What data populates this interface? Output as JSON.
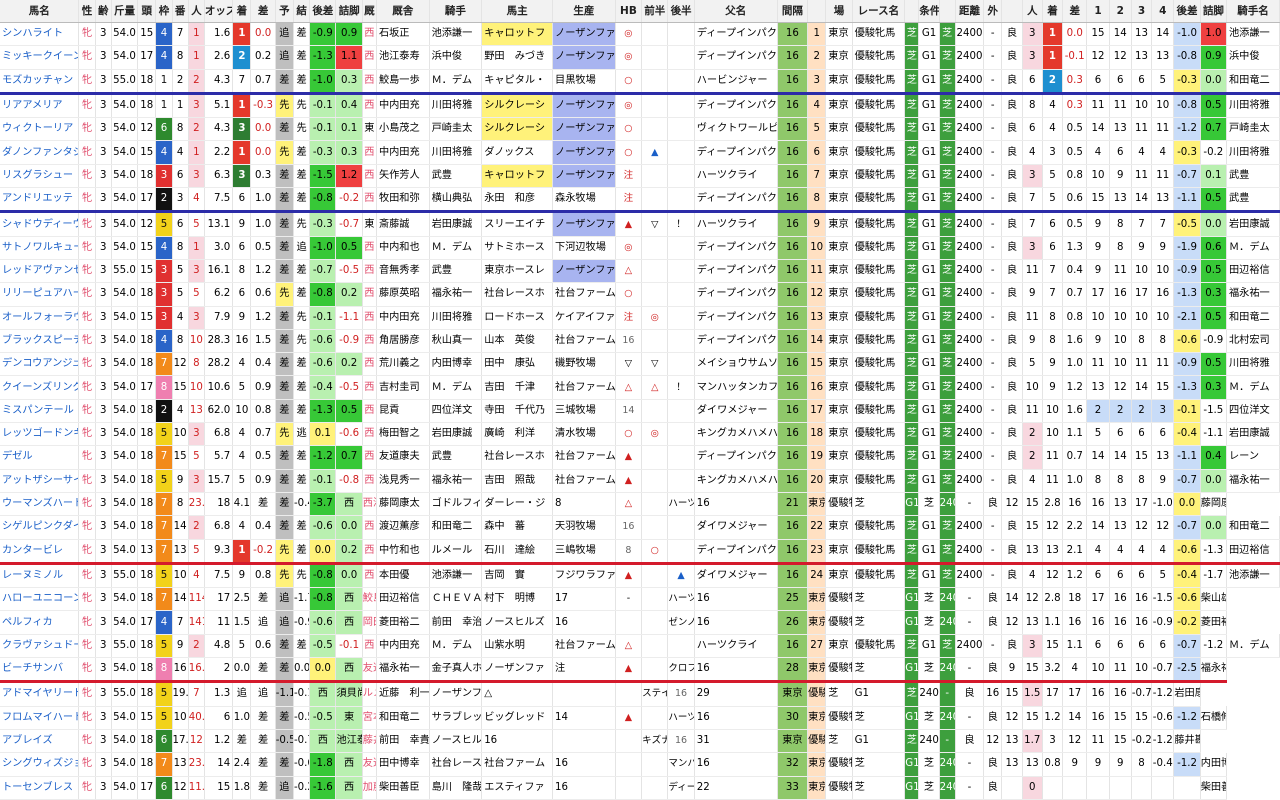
{
  "headers": [
    "馬名",
    "性",
    "齢",
    "斤量",
    "頭",
    "枠",
    "番",
    "人",
    "オッズ",
    "着",
    "差",
    "予",
    "結",
    "後差",
    "詰脚",
    "厩",
    "厩舎",
    "騎手",
    "馬主",
    "生産",
    "HB",
    "前半",
    "後半",
    "父名",
    "間隔",
    "",
    "場",
    "レース名",
    "",
    "条件",
    "",
    "距離",
    "外",
    "",
    "人",
    "着",
    "差",
    "1",
    "2",
    "3",
    "4",
    "後差",
    "詰脚",
    "騎手名"
  ],
  "colors": {
    "blue_sep": "#2c2ca8",
    "red_sep": "#d41a2c",
    "name_blue": "#1a5fc8",
    "green": "#37c837",
    "red": "#ef4040"
  },
  "rows": [
    [
      "シンハライト",
      "牝",
      "3",
      "54.0",
      "15",
      "4",
      "7",
      "1",
      "1.6",
      "1",
      "0.0",
      "追",
      "差",
      "-0.9",
      "0.9",
      "西",
      "石坂正",
      "池添謙一",
      "キャロットフ",
      "ノーザンファ",
      "◎",
      "",
      "",
      "ディープインパクト",
      "16",
      "1",
      "東京",
      "優駿牝馬",
      "芝",
      "G1",
      "芝",
      "2400",
      "-",
      "良",
      "3",
      "1",
      "0.0",
      "15",
      "14",
      "13",
      "14",
      "-1.0",
      "1.0",
      "池添謙一"
    ],
    [
      "ミッキークイーン",
      "牝",
      "3",
      "54.0",
      "17",
      "4",
      "8",
      "1",
      "2.6",
      "2",
      "0.2",
      "追",
      "差",
      "-1.3",
      "1.1",
      "西",
      "池江泰寿",
      "浜中俊",
      "野田　みづき",
      "ノーザンファ",
      "◎",
      "",
      "",
      "ディープインパクト",
      "16",
      "2",
      "東京",
      "優駿牝馬",
      "芝",
      "G1",
      "芝",
      "2400",
      "-",
      "良",
      "3",
      "1",
      "-0.1",
      "12",
      "12",
      "13",
      "13",
      "-0.8",
      "0.9",
      "浜中俊"
    ],
    [
      "モズカッチャン",
      "牝",
      "3",
      "55.0",
      "18",
      "1",
      "2",
      "2",
      "4.3",
      "7",
      "0.7",
      "差",
      "差",
      "-1.0",
      "0.3",
      "西",
      "鮫島一歩",
      "Ｍ．デム",
      "キャピタル・",
      "目黒牧場",
      "○",
      "",
      "",
      "ハービンジャー",
      "16",
      "3",
      "東京",
      "優駿牝馬",
      "芝",
      "G1",
      "芝",
      "2400",
      "-",
      "良",
      "6",
      "2",
      "0.3",
      "6",
      "6",
      "6",
      "5",
      "-0.3",
      "0.0",
      "和田竜二"
    ],
    [
      "リアアメリア",
      "牝",
      "3",
      "54.0",
      "18",
      "1",
      "1",
      "3",
      "5.1",
      "1",
      "-0.3",
      "先",
      "先",
      "-0.1",
      "0.4",
      "西",
      "中内田充",
      "川田将雅",
      "シルクレーシ",
      "ノーザンファ",
      "◎",
      "",
      "",
      "ディープインパクト",
      "16",
      "4",
      "東京",
      "優駿牝馬",
      "芝",
      "G1",
      "芝",
      "2400",
      "-",
      "良",
      "8",
      "4",
      "0.3",
      "11",
      "11",
      "10",
      "10",
      "-0.8",
      "0.5",
      "川田将雅"
    ],
    [
      "ウィクトーリア",
      "牝",
      "3",
      "54.0",
      "12",
      "6",
      "8",
      "2",
      "4.3",
      "3",
      "0.0",
      "差",
      "先",
      "-0.1",
      "0.1",
      "東",
      "小島茂之",
      "戸崎圭太",
      "シルクレーシ",
      "ノーザンファ",
      "○",
      "",
      "",
      "ヴィクトワールピサ",
      "16",
      "5",
      "東京",
      "優駿牝馬",
      "芝",
      "G1",
      "芝",
      "2400",
      "-",
      "良",
      "6",
      "4",
      "0.5",
      "14",
      "13",
      "11",
      "11",
      "-1.2",
      "0.7",
      "戸崎圭太"
    ],
    [
      "ダノンファンタジー",
      "牝",
      "3",
      "54.0",
      "15",
      "4",
      "4",
      "1",
      "2.2",
      "1",
      "0.0",
      "先",
      "差",
      "-0.3",
      "0.3",
      "西",
      "中内田充",
      "川田将雅",
      "ダノックス",
      "ノーザンファ",
      "○",
      "▲",
      "",
      "ディープインパクト",
      "16",
      "6",
      "東京",
      "優駿牝馬",
      "芝",
      "G1",
      "芝",
      "2400",
      "-",
      "良",
      "4",
      "3",
      "0.5",
      "4",
      "6",
      "4",
      "4",
      "-0.3",
      "-0.2",
      "川田将雅"
    ],
    [
      "リスグラシュー",
      "牝",
      "3",
      "54.0",
      "18",
      "3",
      "6",
      "3",
      "6.3",
      "3",
      "0.3",
      "差",
      "差",
      "-1.5",
      "1.2",
      "西",
      "矢作芳人",
      "武豊",
      "キャロットフ",
      "ノーザンファ",
      "注",
      "",
      "",
      "ハーツクライ",
      "16",
      "7",
      "東京",
      "優駿牝馬",
      "芝",
      "G1",
      "芝",
      "2400",
      "-",
      "良",
      "3",
      "5",
      "0.8",
      "10",
      "9",
      "11",
      "11",
      "-0.7",
      "0.1",
      "武豊"
    ],
    [
      "アンドリエッテ",
      "牝",
      "3",
      "54.0",
      "17",
      "2",
      "3",
      "4",
      "7.5",
      "6",
      "1.0",
      "差",
      "差",
      "-0.8",
      "-0.2",
      "西",
      "牧田和弥",
      "横山典弘",
      "永田　和彦",
      "森永牧場",
      "注",
      "",
      "",
      "ディープインパクト",
      "16",
      "8",
      "東京",
      "優駿牝馬",
      "芝",
      "G1",
      "芝",
      "2400",
      "-",
      "良",
      "7",
      "5",
      "0.6",
      "15",
      "13",
      "14",
      "13",
      "-1.1",
      "0.5",
      "武豊"
    ],
    [
      "シャドウディーヴァ",
      "牝",
      "3",
      "54.0",
      "12",
      "5",
      "6",
      "5",
      "13.1",
      "9",
      "1.0",
      "差",
      "先",
      "-0.3",
      "-0.7",
      "東",
      "斎藤誠",
      "岩田康誠",
      "スリーエイチ",
      "ノーザンファ",
      "▲",
      "▽",
      "！",
      "ハーツクライ",
      "16",
      "9",
      "東京",
      "優駿牝馬",
      "芝",
      "G1",
      "芝",
      "2400",
      "-",
      "良",
      "7",
      "6",
      "0.5",
      "9",
      "8",
      "7",
      "7",
      "-0.5",
      "0.0",
      "岩田康誠"
    ],
    [
      "サトノワルキューレ",
      "牝",
      "3",
      "54.0",
      "15",
      "4",
      "8",
      "1",
      "3.0",
      "6",
      "0.5",
      "差",
      "追",
      "-1.0",
      "0.5",
      "西",
      "中内和也",
      "Ｍ．デム",
      "サトミホース",
      "下河辺牧場",
      "◎",
      "",
      "",
      "ディープインパクト",
      "16",
      "10",
      "東京",
      "優駿牝馬",
      "芝",
      "G1",
      "芝",
      "2400",
      "-",
      "良",
      "3",
      "6",
      "1.3",
      "9",
      "8",
      "9",
      "9",
      "-1.9",
      "0.6",
      "Ｍ．デム"
    ],
    [
      "レッドアヴァンセ",
      "牝",
      "3",
      "55.0",
      "15",
      "3",
      "5",
      "3",
      "16.1",
      "8",
      "1.2",
      "差",
      "差",
      "-0.7",
      "-0.5",
      "西",
      "音無秀孝",
      "武豊",
      "東京ホースレ",
      "ノーザンファ",
      "△",
      "",
      "",
      "ディープインパクト",
      "16",
      "11",
      "東京",
      "優駿牝馬",
      "芝",
      "G1",
      "芝",
      "2400",
      "-",
      "良",
      "11",
      "7",
      "0.4",
      "9",
      "11",
      "10",
      "10",
      "-0.9",
      "0.5",
      "田辺裕信"
    ],
    [
      "リリーピュアハート",
      "牝",
      "3",
      "54.0",
      "18",
      "3",
      "5",
      "5",
      "6.2",
      "6",
      "0.6",
      "先",
      "差",
      "-0.8",
      "0.2",
      "西",
      "藤原英昭",
      "福永祐一",
      "社台レースホ",
      "社台ファーム",
      "○",
      "",
      "",
      "ディープインパクト",
      "16",
      "12",
      "東京",
      "優駿牝馬",
      "芝",
      "G1",
      "芝",
      "2400",
      "-",
      "良",
      "9",
      "7",
      "0.7",
      "17",
      "16",
      "17",
      "16",
      "-1.3",
      "0.3",
      "福永祐一"
    ],
    [
      "オールフォーラヴ",
      "牝",
      "3",
      "54.0",
      "15",
      "3",
      "4",
      "3",
      "7.9",
      "9",
      "1.2",
      "差",
      "先",
      "-0.1",
      "-1.1",
      "西",
      "中内田充",
      "川田将雅",
      "ロードホース",
      "ケイアイファ",
      "注",
      "◎",
      "",
      "ディープインパクト",
      "16",
      "13",
      "東京",
      "優駿牝馬",
      "芝",
      "G1",
      "芝",
      "2400",
      "-",
      "良",
      "11",
      "8",
      "0.8",
      "10",
      "10",
      "10",
      "10",
      "-2.1",
      "0.5",
      "和田竜二"
    ],
    [
      "ブラックスピーチ",
      "牝",
      "3",
      "54.0",
      "18",
      "4",
      "8",
      "10",
      "28.3",
      "16",
      "1.5",
      "差",
      "先",
      "-0.6",
      "-0.9",
      "西",
      "角居勝彦",
      "秋山真一",
      "山本　英俊",
      "社台ファーム",
      "16",
      "",
      "",
      "ディープインパクト",
      "16",
      "14",
      "東京",
      "優駿牝馬",
      "芝",
      "G1",
      "芝",
      "2400",
      "-",
      "良",
      "9",
      "8",
      "1.6",
      "9",
      "10",
      "8",
      "8",
      "-0.6",
      "-0.9",
      "北村宏司"
    ],
    [
      "デンコウアンジュ",
      "牝",
      "3",
      "54.0",
      "18",
      "7",
      "12",
      "8",
      "28.2",
      "4",
      "0.4",
      "差",
      "差",
      "-0.6",
      "0.2",
      "西",
      "荒川義之",
      "内田博幸",
      "田中　康弘",
      "磯野牧場",
      "▽",
      "▽",
      "",
      "メイショウサムソン",
      "16",
      "15",
      "東京",
      "優駿牝馬",
      "芝",
      "G1",
      "芝",
      "2400",
      "-",
      "良",
      "5",
      "9",
      "1.0",
      "11",
      "10",
      "11",
      "11",
      "-0.9",
      "0.5",
      "川田将雅"
    ],
    [
      "クイーンズリング",
      "牝",
      "3",
      "54.0",
      "17",
      "8",
      "15",
      "10",
      "10.6",
      "5",
      "0.9",
      "差",
      "差",
      "-0.4",
      "-0.5",
      "西",
      "吉村圭司",
      "Ｍ．デム",
      "吉田　千津",
      "社台ファーム",
      "△",
      "△",
      "！",
      "マンハッタンカフェ",
      "16",
      "16",
      "東京",
      "優駿牝馬",
      "芝",
      "G1",
      "芝",
      "2400",
      "-",
      "良",
      "10",
      "9",
      "1.2",
      "13",
      "12",
      "14",
      "15",
      "-1.3",
      "0.3",
      "Ｍ．デム"
    ],
    [
      "ミスパンテール",
      "牝",
      "3",
      "54.0",
      "18",
      "2",
      "4",
      "13",
      "62.0",
      "10",
      "0.8",
      "差",
      "差",
      "-1.3",
      "0.5",
      "西",
      "昆貢",
      "四位洋文",
      "寺田　千代乃",
      "三城牧場",
      "14",
      "",
      "",
      "ダイワメジャー",
      "16",
      "17",
      "東京",
      "優駿牝馬",
      "芝",
      "G1",
      "芝",
      "2400",
      "-",
      "良",
      "11",
      "10",
      "1.6",
      "2",
      "2",
      "2",
      "3",
      "-0.1",
      "-1.5",
      "四位洋文"
    ],
    [
      "レッツゴードンキ",
      "牝",
      "3",
      "54.0",
      "18",
      "5",
      "10",
      "3",
      "6.8",
      "4",
      "0.7",
      "先",
      "逃",
      "0.1",
      "-0.6",
      "西",
      "梅田智之",
      "岩田康誠",
      "廣崎　利洋",
      "清水牧場",
      "○",
      "◎",
      "",
      "キングカメハメハ",
      "16",
      "18",
      "東京",
      "優駿牝馬",
      "芝",
      "G1",
      "芝",
      "2400",
      "-",
      "良",
      "2",
      "10",
      "1.1",
      "5",
      "6",
      "6",
      "6",
      "-0.4",
      "-1.1",
      "岩田康誠"
    ],
    [
      "デゼル",
      "牝",
      "3",
      "54.0",
      "18",
      "7",
      "15",
      "5",
      "5.7",
      "4",
      "0.5",
      "差",
      "差",
      "-1.2",
      "0.7",
      "西",
      "友道康夫",
      "武豊",
      "社台レースホ",
      "社台ファーム",
      "▲",
      "",
      "",
      "ディープインパクト",
      "16",
      "19",
      "東京",
      "優駿牝馬",
      "芝",
      "G1",
      "芝",
      "2400",
      "-",
      "良",
      "2",
      "11",
      "0.7",
      "14",
      "14",
      "15",
      "13",
      "-1.1",
      "0.4",
      "レーン"
    ],
    [
      "アットザシーサイド",
      "牝",
      "3",
      "54.0",
      "18",
      "5",
      "9",
      "3",
      "15.7",
      "5",
      "0.9",
      "差",
      "差",
      "-0.1",
      "-0.8",
      "西",
      "浅見秀一",
      "福永祐一",
      "吉田　照哉",
      "社台ファーム",
      "▲",
      "",
      "",
      "キングカメハメハ",
      "16",
      "20",
      "東京",
      "優駿牝馬",
      "芝",
      "G1",
      "芝",
      "2400",
      "-",
      "良",
      "4",
      "11",
      "1.0",
      "8",
      "8",
      "8",
      "9",
      "-0.7",
      "0.0",
      "福永祐一"
    ],
    [
      "ウーマンズハート",
      "牝",
      "3",
      "54.0",
      "18",
      "7",
      "8",
      "23.3",
      "18",
      "4.1",
      "差",
      "差",
      "-0.4",
      "-3.7",
      "西",
      "西浦勝一",
      "藤岡康太",
      "ゴドルフィン",
      "ダーレー・ジ",
      "8",
      "△",
      "",
      "ハーツクライ",
      "16",
      "21",
      "東京",
      "優駿牝馬",
      "芝",
      "G1",
      "芝",
      "2400",
      "-",
      "良",
      "12",
      "15",
      "2.8",
      "16",
      "16",
      "13",
      "17",
      "-1.0",
      "0.0",
      "藤岡康太"
    ],
    [
      "シゲルピンクダイヤ",
      "牝",
      "3",
      "54.0",
      "18",
      "7",
      "14",
      "2",
      "6.8",
      "4",
      "0.4",
      "差",
      "差",
      "-0.6",
      "0.0",
      "西",
      "渡辺薫彦",
      "和田竜二",
      "森中　蕃",
      "天羽牧場",
      "16",
      "",
      "",
      "ダイワメジャー",
      "16",
      "22",
      "東京",
      "優駿牝馬",
      "芝",
      "G1",
      "芝",
      "2400",
      "-",
      "良",
      "15",
      "12",
      "2.2",
      "14",
      "13",
      "12",
      "12",
      "-0.7",
      "0.0",
      "和田竜二"
    ],
    [
      "カンタービレ",
      "牝",
      "3",
      "54.0",
      "13",
      "7",
      "13",
      "5",
      "9.3",
      "1",
      "-0.2",
      "先",
      "差",
      "0.0",
      "0.2",
      "西",
      "中竹和也",
      "ルメール",
      "石川　達絵",
      "三嶋牧場",
      "8",
      "○",
      "",
      "ディープインパクト",
      "16",
      "23",
      "東京",
      "優駿牝馬",
      "芝",
      "G1",
      "芝",
      "2400",
      "-",
      "良",
      "13",
      "13",
      "2.1",
      "4",
      "4",
      "4",
      "4",
      "-0.6",
      "-1.3",
      "田辺裕信"
    ],
    [
      "レーヌミノル",
      "牝",
      "3",
      "55.0",
      "18",
      "5",
      "10",
      "4",
      "7.5",
      "9",
      "0.8",
      "先",
      "先",
      "-0.8",
      "0.0",
      "西",
      "本田優",
      "池添謙一",
      "吉岡　實",
      "フジワラファ",
      "▲",
      "",
      "▲",
      "ダイワメジャー",
      "16",
      "24",
      "東京",
      "優駿牝馬",
      "芝",
      "G1",
      "芝",
      "2400",
      "-",
      "良",
      "4",
      "12",
      "1.2",
      "6",
      "6",
      "6",
      "5",
      "-0.4",
      "-1.7",
      "池添謙一"
    ],
    [
      "ハローユニコーン",
      "牝",
      "3",
      "54.0",
      "18",
      "7",
      "14",
      "114.1",
      "17",
      "2.5",
      "差",
      "追",
      "-1.7",
      "-0.8",
      "西",
      "鮫島一歩",
      "田辺裕信",
      "ＣＨＥＶＡＬ",
      "村下　明博",
      "17",
      "-",
      "",
      "ハーツクライ",
      "16",
      "25",
      "東京",
      "優駿牝馬",
      "芝",
      "G1",
      "芝",
      "2400",
      "-",
      "良",
      "14",
      "12",
      "2.8",
      "18",
      "17",
      "16",
      "16",
      "-1.5",
      "-0.6",
      "柴山雄一"
    ],
    [
      "ペルフィカ",
      "牝",
      "3",
      "54.0",
      "17",
      "4",
      "7",
      "141.7",
      "11",
      "1.5",
      "追",
      "追",
      "-0.9",
      "-0.6",
      "西",
      "岡田稲男",
      "菱田裕二",
      "前田　幸治",
      "ノースヒルズ",
      "16",
      "",
      "",
      "ゼンノロブロイ",
      "16",
      "26",
      "東京",
      "優駿牝馬",
      "芝",
      "G1",
      "芝",
      "2400",
      "-",
      "良",
      "12",
      "13",
      "1.1",
      "16",
      "16",
      "16",
      "16",
      "-0.9",
      "-0.2",
      "菱田裕二"
    ],
    [
      "クラヴァシュドール",
      "牝",
      "3",
      "55.0",
      "18",
      "5",
      "9",
      "2",
      "4.8",
      "5",
      "0.6",
      "差",
      "差",
      "-0.5",
      "-0.1",
      "西",
      "中内田充",
      "Ｍ．デム",
      "山紫水明",
      "社台ファーム",
      "△",
      "",
      "",
      "ハーツクライ",
      "16",
      "27",
      "東京",
      "優駿牝馬",
      "芝",
      "G1",
      "芝",
      "2400",
      "-",
      "良",
      "3",
      "15",
      "1.1",
      "6",
      "6",
      "6",
      "6",
      "-0.7",
      "-1.2",
      "Ｍ．デム"
    ],
    [
      "ビーチサンバ",
      "牝",
      "3",
      "54.0",
      "18",
      "8",
      "16",
      "16.0",
      "2",
      "0.0",
      "差",
      "差",
      "0.0",
      "0.0",
      "西",
      "友道康夫",
      "福永祐一",
      "金子真人ホー",
      "ノーザンファ",
      "注",
      "▲",
      "",
      "クロフネ",
      "16",
      "28",
      "東京",
      "優駿牝馬",
      "芝",
      "G1",
      "芝",
      "2400",
      "-",
      "良",
      "9",
      "15",
      "3.2",
      "4",
      "10",
      "11",
      "10",
      "-0.7",
      "-2.5",
      "福永祐一"
    ],
    [
      "アドマイヤリード",
      "牝",
      "3",
      "55.0",
      "18",
      "5",
      "19.3",
      "7",
      "1.3",
      "追",
      "追",
      "-1.1",
      "-0.1",
      "西",
      "須貝尚介",
      "ルメール",
      "近藤　利一",
      "ノーザンファ",
      "△",
      "",
      "",
      "ステイゴールド",
      "16",
      "29",
      "東京",
      "優駿牝馬",
      "芝",
      "G1",
      "芝",
      "2400",
      "-",
      "良",
      "16",
      "15",
      "1.5",
      "17",
      "17",
      "16",
      "16",
      "-0.7",
      "-1.2",
      "岩田康誠"
    ],
    [
      "フロムマイハート",
      "牝",
      "3",
      "54.0",
      "15",
      "5",
      "10",
      "40.7",
      "6",
      "1.0",
      "差",
      "差",
      "-0.5",
      "-0.5",
      "東",
      "宮本博",
      "和田竜二",
      "サラブレッド",
      "ビッグレッド",
      "14",
      "▲",
      "",
      "ハーツクライ",
      "16",
      "30",
      "東京",
      "優駿牝馬",
      "芝",
      "G1",
      "芝",
      "2400",
      "-",
      "良",
      "12",
      "15",
      "1.2",
      "14",
      "16",
      "15",
      "15",
      "-0.6",
      "-1.2",
      "石橋脩"
    ],
    [
      "アブレイズ",
      "牝",
      "3",
      "54.0",
      "18",
      "6",
      "17.6",
      "12",
      "1.2",
      "差",
      "差",
      "-0.5",
      "-0.7",
      "西",
      "池江泰寿",
      "藤井勘一",
      "前田　幸貴",
      "ノースヒルズ",
      "16",
      "",
      "",
      "キズナ",
      "16",
      "31",
      "東京",
      "優駿牝馬",
      "芝",
      "G1",
      "芝",
      "2400",
      "-",
      "良",
      "12",
      "13",
      "1.7",
      "3",
      "12",
      "11",
      "15",
      "-0.2",
      "-1.2",
      "藤井勘一"
    ],
    [
      "シングウィズジョイ",
      "牝",
      "3",
      "54.0",
      "18",
      "7",
      "13",
      "23.4",
      "14",
      "2.4",
      "差",
      "差",
      "-0.6",
      "-1.8",
      "西",
      "友道康夫",
      "田中博幸",
      "社台レースホ",
      "社台ファーム",
      "16",
      "",
      "",
      "マンハッタンカフェ",
      "16",
      "32",
      "東京",
      "優駿牝馬",
      "芝",
      "G1",
      "芝",
      "2400",
      "-",
      "良",
      "13",
      "13",
      "0.8",
      "9",
      "9",
      "9",
      "8",
      "-0.4",
      "-1.2",
      "内田博幸"
    ],
    [
      "トーセンブレス",
      "牝",
      "3",
      "54.0",
      "17",
      "6",
      "12",
      "11.5",
      "15",
      "1.8",
      "差",
      "追",
      "-0.2",
      "-1.6",
      "西",
      "加藤征弘",
      "柴田善臣",
      "島川　隆哉",
      "エスティファ",
      "16",
      "",
      "",
      "ディープインパクト",
      "22",
      "33",
      "東京",
      "優駿牝馬",
      "芝",
      "G1",
      "芝",
      "2400",
      "-",
      "良",
      "",
      "0",
      "",
      "",
      "",
      "",
      "",
      "",
      "",
      "柴田善臣"
    ]
  ]
}
